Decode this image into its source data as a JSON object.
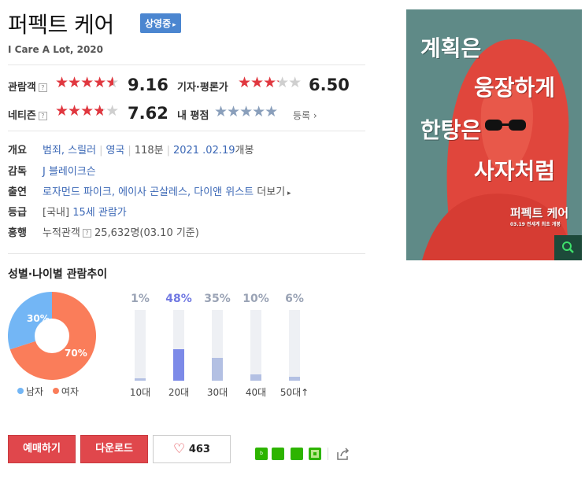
{
  "movie": {
    "title": "퍼펙트 케어",
    "status_badge": "상영중",
    "subtitle": "I Care A Lot, 2020"
  },
  "ratings": {
    "audience": {
      "label": "관람객",
      "score": "9.16",
      "stars": 4.58
    },
    "critics": {
      "label": "기자·평론가",
      "score": "6.50",
      "stars": 3.25
    },
    "netizen": {
      "label": "네티즌",
      "score": "7.62",
      "stars": 3.81
    },
    "my_rating": {
      "label": "내 평점",
      "register_label": "등록"
    }
  },
  "info": {
    "overview": {
      "label": "개요",
      "genre": "범죄, 스릴러",
      "country": "영국",
      "runtime": "118분",
      "release_date": "2021 .02.19",
      "release_suffix": "개봉"
    },
    "director": {
      "label": "감독",
      "name": "J 블레이크슨"
    },
    "cast": {
      "label": "출연",
      "names": "로자먼드 파이크, 에이사 곤살레스, 다이앤 위스트",
      "more_label": "더보기"
    },
    "rating": {
      "label": "등급",
      "prefix": "[국내]",
      "value": "15세 관람가"
    },
    "box_office": {
      "label": "흥행",
      "audience_label": "누적관객",
      "value": "25,632명(03.10 기준)"
    }
  },
  "demographics": {
    "section_title": "성별·나이별 관람추이",
    "gender": {
      "male": {
        "label": "남자",
        "pct_label": "30%",
        "value": 30,
        "color": "#73b6f5"
      },
      "female": {
        "label": "여자",
        "pct_label": "70%",
        "value": 70,
        "color": "#fa7d5a"
      }
    },
    "age": [
      {
        "label": "10대",
        "pct_label": "1%",
        "value": 1
      },
      {
        "label": "20대",
        "pct_label": "48%",
        "value": 48,
        "highlight": true
      },
      {
        "label": "30대",
        "pct_label": "35%",
        "value": 35
      },
      {
        "label": "40대",
        "pct_label": "10%",
        "value": 10
      },
      {
        "label": "50대",
        "pct_label": "6%",
        "value": 6,
        "suffix": "↑"
      }
    ]
  },
  "actions": {
    "reserve_label": "예매하기",
    "download_label": "다운로드",
    "like_count": "463"
  },
  "poster": {
    "tagline_lines": [
      "계획은",
      "웅장하게",
      "한탕은",
      "사자처럼"
    ],
    "title": "퍼펙트 케어",
    "release_note": "03.19 전세계 최초 개봉"
  },
  "colors": {
    "star_red": "#e0373f",
    "accent_blue": "#3c68b6",
    "button_red": "#e0474c",
    "poster_bg": "#5f8a87"
  }
}
